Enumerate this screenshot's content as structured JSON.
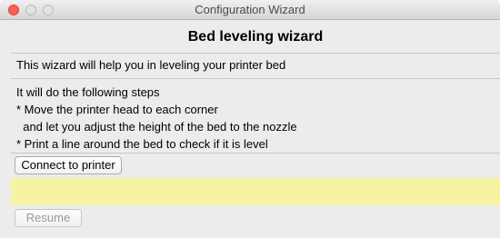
{
  "window": {
    "title": "Configuration Wizard"
  },
  "wizard": {
    "heading": "Bed leveling wizard",
    "intro": "This wizard will help you in leveling your printer bed",
    "steps": [
      "It will do the following steps",
      "* Move the printer head to each corner",
      "  and let you adjust the height of the bed to the nozzle",
      "* Print a line around the bed to check if it is level"
    ],
    "connect_button": "Connect to printer",
    "status_text": "",
    "resume_button": "Resume",
    "resume_enabled": false
  },
  "colors": {
    "close_button": "#fc5f57",
    "status_bar": "#f7f3a2",
    "window_bg": "#ececec"
  }
}
